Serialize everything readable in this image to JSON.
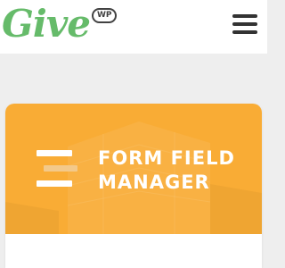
{
  "header": {
    "logo_text": "Give",
    "logo_badge": "WP",
    "menu_icon": "hamburger-menu-icon"
  },
  "colors": {
    "brand_green": "#66bb6a",
    "banner_orange": "#f9ac35",
    "page_bg": "#eeeeee"
  },
  "card": {
    "title_line1": "FORM FIELD",
    "title_line2": "MANAGER",
    "icon": "form-fields-icon"
  }
}
